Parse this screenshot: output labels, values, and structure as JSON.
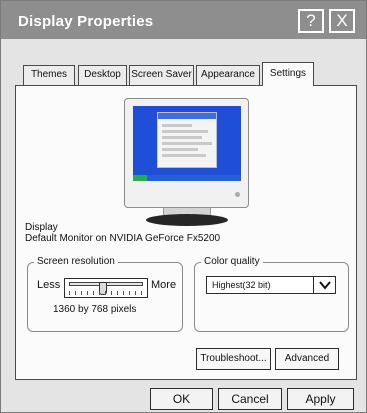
{
  "window": {
    "title": "Display Properties",
    "help_glyph": "?",
    "close_glyph": "X"
  },
  "tabs": [
    {
      "label": "Themes"
    },
    {
      "label": "Desktop"
    },
    {
      "label": "Screen Saver"
    },
    {
      "label": "Appearance"
    },
    {
      "label": "Settings",
      "active": true
    }
  ],
  "display": {
    "label": "Display",
    "description": "Default Monitor on NVIDIA  GeForce Fx5200"
  },
  "screen_resolution": {
    "legend": "Screen resolution",
    "less_label": "Less",
    "more_label": "More",
    "value_text": "1360 by 768 pixels",
    "slider_level": 0.46
  },
  "color_quality": {
    "legend": "Color quality",
    "selected": "Highest(32 bit)"
  },
  "buttons": {
    "troubleshoot": "Troubleshoot...",
    "advanced": "Advanced",
    "ok": "OK",
    "cancel": "Cancel",
    "apply": "Apply"
  },
  "icons": {
    "help": "help-icon",
    "close": "close-icon",
    "dropdown": "chevron-down-icon",
    "monitor": "monitor-preview-icon"
  }
}
